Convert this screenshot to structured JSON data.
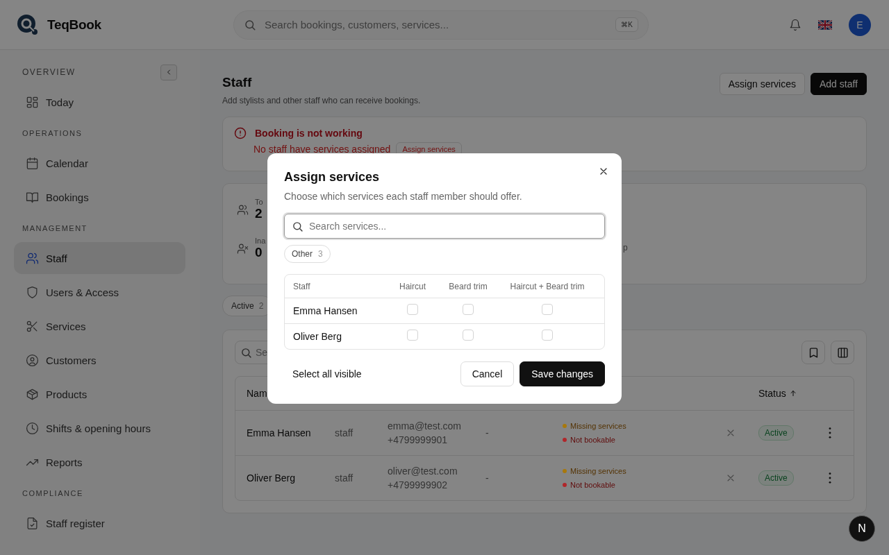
{
  "header": {
    "brand": "TeqBook",
    "search_placeholder": "Search bookings, customers, services...",
    "shortcut": "⌘K",
    "avatar": "E"
  },
  "sidebar": {
    "sections": [
      {
        "title": "OVERVIEW",
        "items": [
          {
            "label": "Today",
            "selected": false
          }
        ]
      },
      {
        "title": "OPERATIONS",
        "items": [
          {
            "label": "Calendar",
            "selected": false
          },
          {
            "label": "Bookings",
            "selected": false
          }
        ]
      },
      {
        "title": "MANAGEMENT",
        "items": [
          {
            "label": "Staff",
            "selected": true
          },
          {
            "label": "Users & Access",
            "selected": false
          },
          {
            "label": "Services",
            "selected": false
          },
          {
            "label": "Customers",
            "selected": false
          },
          {
            "label": "Products",
            "selected": false
          },
          {
            "label": "Shifts & opening hours",
            "selected": false
          },
          {
            "label": "Reports",
            "selected": false
          }
        ]
      },
      {
        "title": "COMPLIANCE",
        "items": [
          {
            "label": "Staff register",
            "selected": false
          }
        ]
      }
    ]
  },
  "page": {
    "title": "Staff",
    "subtitle": "Add stylists and other staff who can receive bookings.",
    "buttons": [
      {
        "label": "Assign services",
        "kind": "outline"
      },
      {
        "label": "Add staff",
        "kind": "primary"
      }
    ]
  },
  "alert": {
    "title": "Booking is not working",
    "message": "No staff have services assigned",
    "action": "Assign services"
  },
  "stats": [
    {
      "label": "To",
      "value": "2"
    },
    {
      "label": "Ina",
      "value": "0"
    }
  ],
  "stats_tail": "p",
  "filters": [
    {
      "label": "Active",
      "count": "2"
    }
  ],
  "table": {
    "search_placeholder": "Se",
    "columns": [
      "Nam",
      "Status"
    ],
    "rows": [
      {
        "name": "Emma Hansen",
        "role": "staff",
        "email": "emma@test.com",
        "phone": "+4799999901",
        "column_4": "-",
        "badges": [
          {
            "label": "Missing services",
            "kind": "warning",
            "color": "#a8780c"
          },
          {
            "label": "Not bookable",
            "kind": "error",
            "color": "#b0262a"
          }
        ],
        "status": "Active"
      },
      {
        "name": "Oliver Berg",
        "role": "staff",
        "email": "oliver@test.com",
        "phone": "+4799999902",
        "column_4": "-",
        "badges": [
          {
            "label": "Missing services",
            "kind": "warning",
            "color": "#a8780c"
          },
          {
            "label": "Not bookable",
            "kind": "error",
            "color": "#b0262a"
          }
        ],
        "status": "Active"
      }
    ]
  },
  "modal": {
    "title": "Assign services",
    "description": "Choose which services each staff member should offer.",
    "search_placeholder": "Search services...",
    "chips": [
      {
        "label": "Other",
        "count": "3"
      }
    ],
    "columns": [
      "Staff",
      "Haircut",
      "Beard trim",
      "Haircut + Beard trim"
    ],
    "rows": [
      {
        "name": "Emma Hansen",
        "checks": [
          false,
          false,
          false
        ]
      },
      {
        "name": "Oliver Berg",
        "checks": [
          false,
          false,
          false
        ]
      }
    ],
    "select_all": "Select all visible",
    "buttons": [
      {
        "label": "Cancel",
        "kind": "outline"
      },
      {
        "label": "Save changes",
        "kind": "primary"
      }
    ]
  },
  "dev_badge": "N"
}
